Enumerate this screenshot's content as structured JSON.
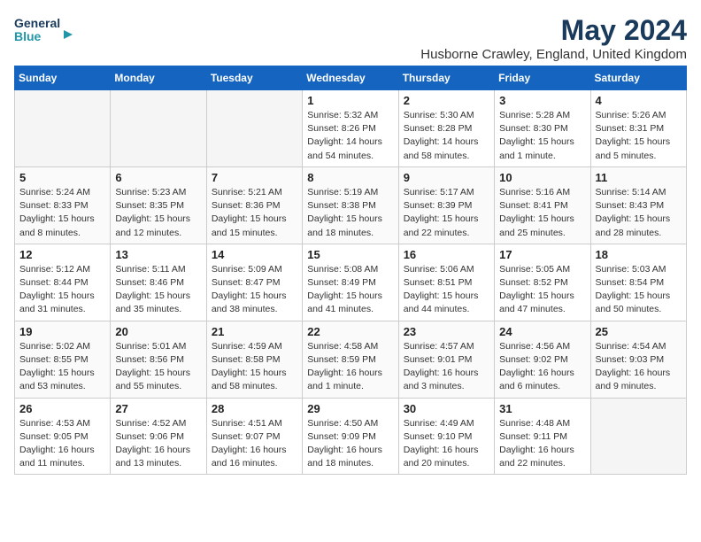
{
  "logo": {
    "line1": "General",
    "line2": "Blue",
    "icon_color": "#2196a8"
  },
  "title": "May 2024",
  "subtitle": "Husborne Crawley, England, United Kingdom",
  "days_of_week": [
    "Sunday",
    "Monday",
    "Tuesday",
    "Wednesday",
    "Thursday",
    "Friday",
    "Saturday"
  ],
  "weeks": [
    [
      {
        "day": "",
        "sunrise": "",
        "sunset": "",
        "daylight": ""
      },
      {
        "day": "",
        "sunrise": "",
        "sunset": "",
        "daylight": ""
      },
      {
        "day": "",
        "sunrise": "",
        "sunset": "",
        "daylight": ""
      },
      {
        "day": "1",
        "sunrise": "Sunrise: 5:32 AM",
        "sunset": "Sunset: 8:26 PM",
        "daylight": "Daylight: 14 hours and 54 minutes."
      },
      {
        "day": "2",
        "sunrise": "Sunrise: 5:30 AM",
        "sunset": "Sunset: 8:28 PM",
        "daylight": "Daylight: 14 hours and 58 minutes."
      },
      {
        "day": "3",
        "sunrise": "Sunrise: 5:28 AM",
        "sunset": "Sunset: 8:30 PM",
        "daylight": "Daylight: 15 hours and 1 minute."
      },
      {
        "day": "4",
        "sunrise": "Sunrise: 5:26 AM",
        "sunset": "Sunset: 8:31 PM",
        "daylight": "Daylight: 15 hours and 5 minutes."
      }
    ],
    [
      {
        "day": "5",
        "sunrise": "Sunrise: 5:24 AM",
        "sunset": "Sunset: 8:33 PM",
        "daylight": "Daylight: 15 hours and 8 minutes."
      },
      {
        "day": "6",
        "sunrise": "Sunrise: 5:23 AM",
        "sunset": "Sunset: 8:35 PM",
        "daylight": "Daylight: 15 hours and 12 minutes."
      },
      {
        "day": "7",
        "sunrise": "Sunrise: 5:21 AM",
        "sunset": "Sunset: 8:36 PM",
        "daylight": "Daylight: 15 hours and 15 minutes."
      },
      {
        "day": "8",
        "sunrise": "Sunrise: 5:19 AM",
        "sunset": "Sunset: 8:38 PM",
        "daylight": "Daylight: 15 hours and 18 minutes."
      },
      {
        "day": "9",
        "sunrise": "Sunrise: 5:17 AM",
        "sunset": "Sunset: 8:39 PM",
        "daylight": "Daylight: 15 hours and 22 minutes."
      },
      {
        "day": "10",
        "sunrise": "Sunrise: 5:16 AM",
        "sunset": "Sunset: 8:41 PM",
        "daylight": "Daylight: 15 hours and 25 minutes."
      },
      {
        "day": "11",
        "sunrise": "Sunrise: 5:14 AM",
        "sunset": "Sunset: 8:43 PM",
        "daylight": "Daylight: 15 hours and 28 minutes."
      }
    ],
    [
      {
        "day": "12",
        "sunrise": "Sunrise: 5:12 AM",
        "sunset": "Sunset: 8:44 PM",
        "daylight": "Daylight: 15 hours and 31 minutes."
      },
      {
        "day": "13",
        "sunrise": "Sunrise: 5:11 AM",
        "sunset": "Sunset: 8:46 PM",
        "daylight": "Daylight: 15 hours and 35 minutes."
      },
      {
        "day": "14",
        "sunrise": "Sunrise: 5:09 AM",
        "sunset": "Sunset: 8:47 PM",
        "daylight": "Daylight: 15 hours and 38 minutes."
      },
      {
        "day": "15",
        "sunrise": "Sunrise: 5:08 AM",
        "sunset": "Sunset: 8:49 PM",
        "daylight": "Daylight: 15 hours and 41 minutes."
      },
      {
        "day": "16",
        "sunrise": "Sunrise: 5:06 AM",
        "sunset": "Sunset: 8:51 PM",
        "daylight": "Daylight: 15 hours and 44 minutes."
      },
      {
        "day": "17",
        "sunrise": "Sunrise: 5:05 AM",
        "sunset": "Sunset: 8:52 PM",
        "daylight": "Daylight: 15 hours and 47 minutes."
      },
      {
        "day": "18",
        "sunrise": "Sunrise: 5:03 AM",
        "sunset": "Sunset: 8:54 PM",
        "daylight": "Daylight: 15 hours and 50 minutes."
      }
    ],
    [
      {
        "day": "19",
        "sunrise": "Sunrise: 5:02 AM",
        "sunset": "Sunset: 8:55 PM",
        "daylight": "Daylight: 15 hours and 53 minutes."
      },
      {
        "day": "20",
        "sunrise": "Sunrise: 5:01 AM",
        "sunset": "Sunset: 8:56 PM",
        "daylight": "Daylight: 15 hours and 55 minutes."
      },
      {
        "day": "21",
        "sunrise": "Sunrise: 4:59 AM",
        "sunset": "Sunset: 8:58 PM",
        "daylight": "Daylight: 15 hours and 58 minutes."
      },
      {
        "day": "22",
        "sunrise": "Sunrise: 4:58 AM",
        "sunset": "Sunset: 8:59 PM",
        "daylight": "Daylight: 16 hours and 1 minute."
      },
      {
        "day": "23",
        "sunrise": "Sunrise: 4:57 AM",
        "sunset": "Sunset: 9:01 PM",
        "daylight": "Daylight: 16 hours and 3 minutes."
      },
      {
        "day": "24",
        "sunrise": "Sunrise: 4:56 AM",
        "sunset": "Sunset: 9:02 PM",
        "daylight": "Daylight: 16 hours and 6 minutes."
      },
      {
        "day": "25",
        "sunrise": "Sunrise: 4:54 AM",
        "sunset": "Sunset: 9:03 PM",
        "daylight": "Daylight: 16 hours and 9 minutes."
      }
    ],
    [
      {
        "day": "26",
        "sunrise": "Sunrise: 4:53 AM",
        "sunset": "Sunset: 9:05 PM",
        "daylight": "Daylight: 16 hours and 11 minutes."
      },
      {
        "day": "27",
        "sunrise": "Sunrise: 4:52 AM",
        "sunset": "Sunset: 9:06 PM",
        "daylight": "Daylight: 16 hours and 13 minutes."
      },
      {
        "day": "28",
        "sunrise": "Sunrise: 4:51 AM",
        "sunset": "Sunset: 9:07 PM",
        "daylight": "Daylight: 16 hours and 16 minutes."
      },
      {
        "day": "29",
        "sunrise": "Sunrise: 4:50 AM",
        "sunset": "Sunset: 9:09 PM",
        "daylight": "Daylight: 16 hours and 18 minutes."
      },
      {
        "day": "30",
        "sunrise": "Sunrise: 4:49 AM",
        "sunset": "Sunset: 9:10 PM",
        "daylight": "Daylight: 16 hours and 20 minutes."
      },
      {
        "day": "31",
        "sunrise": "Sunrise: 4:48 AM",
        "sunset": "Sunset: 9:11 PM",
        "daylight": "Daylight: 16 hours and 22 minutes."
      },
      {
        "day": "",
        "sunrise": "",
        "sunset": "",
        "daylight": ""
      }
    ]
  ]
}
